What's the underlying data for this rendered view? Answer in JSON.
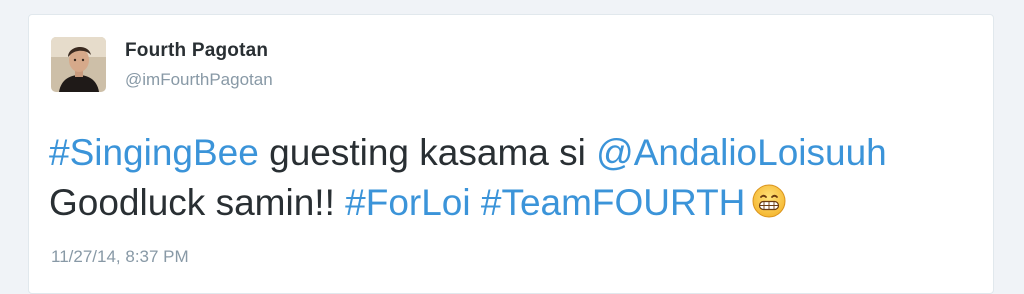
{
  "user": {
    "display_name": "Fourth Pagotan",
    "handle": "@imFourthPagotan",
    "avatar_icon": "profile-photo"
  },
  "tweet": {
    "line1": {
      "hashtag": "#SingingBee",
      "text": " guesting kasama si ",
      "mention": "@AndalioLoisuuh"
    },
    "line2": {
      "text": "Goodluck samin!! ",
      "hashtag1": "#ForLoi",
      "space": " ",
      "hashtag2": "#TeamFOURTH"
    },
    "emoji_icon": "grinning-face-icon",
    "timestamp": "11/27/14, 8:37 PM"
  },
  "colors": {
    "link": "#3b94d9",
    "text": "#292f33",
    "muted": "#8899a6",
    "background": "#f0f3f7"
  }
}
